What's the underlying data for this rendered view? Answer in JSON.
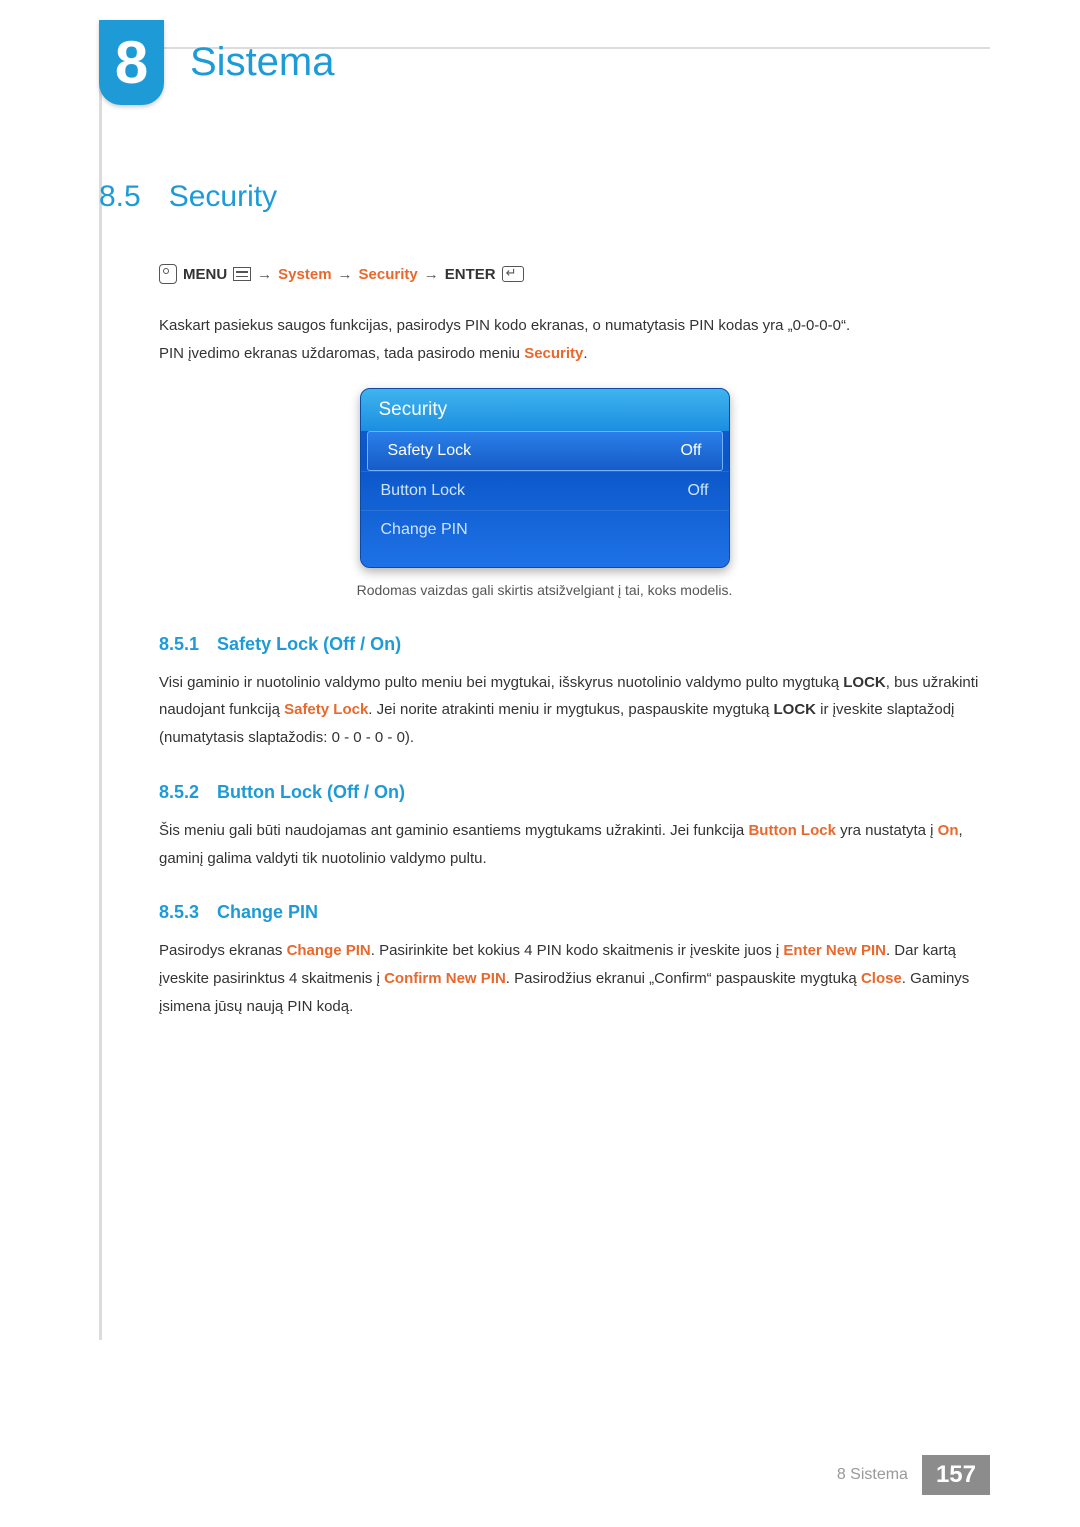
{
  "chapter": {
    "number": "8",
    "title": "Sistema"
  },
  "section": {
    "number": "8.5",
    "title": "Security"
  },
  "nav": {
    "menu": "MENU",
    "arrow": "→",
    "system": "System",
    "security": "Security",
    "enter": "ENTER"
  },
  "intro": {
    "line1": "Kaskart pasiekus saugos funkcijas, pasirodys PIN kodo ekranas, o numatytasis PIN kodas yra „0-0-0-0“.",
    "line2a": "PIN įvedimo ekranas uždaromas, tada pasirodo meniu ",
    "line2b": "Security",
    "line2c": "."
  },
  "osd": {
    "title": "Security",
    "rows": [
      {
        "label": "Safety Lock",
        "value": "Off",
        "selected": true
      },
      {
        "label": "Button Lock",
        "value": "Off",
        "selected": false
      },
      {
        "label": "Change PIN",
        "value": "",
        "selected": false
      }
    ]
  },
  "caption": "Rodomas vaizdas gali skirtis atsižvelgiant į tai, koks modelis.",
  "sub1": {
    "num": "8.5.1",
    "title": "Safety Lock (Off / On)",
    "p1": "Visi gaminio ir nuotolinio valdymo pulto meniu bei mygtukai, išskyrus nuotolinio valdymo pulto mygtuką ",
    "p2": "LOCK",
    "p3": ", bus užrakinti naudojant funkciją ",
    "p4": "Safety Lock",
    "p5": ". Jei norite atrakinti meniu ir mygtukus, paspauskite mygtuką ",
    "p6": "LOCK",
    "p7": " ir įveskite slaptažodį (numatytasis slaptažodis: 0 - 0 - 0 - 0)."
  },
  "sub2": {
    "num": "8.5.2",
    "title": "Button Lock (Off / On)",
    "p1": "Šis meniu gali būti naudojamas ant gaminio esantiems mygtukams užrakinti. Jei funkcija ",
    "p2": "Button Lock",
    "p3": " yra nustatyta į ",
    "p4": "On",
    "p5": ", gaminį galima valdyti tik nuotolinio valdymo pultu."
  },
  "sub3": {
    "num": "8.5.3",
    "title": "Change PIN",
    "p1": "Pasirodys ekranas ",
    "p2": "Change PIN",
    "p3": ". Pasirinkite bet kokius 4 PIN kodo skaitmenis ir įveskite juos į ",
    "p4": "Enter New PIN",
    "p5": ". Dar kartą įveskite pasirinktus 4 skaitmenis į ",
    "p6": "Confirm New PIN",
    "p7": ". Pasirodžius ekranui „Confirm“ paspauskite mygtuką ",
    "p8": "Close",
    "p9": ". Gaminys įsimena jūsų naują PIN kodą."
  },
  "footer": {
    "label": "8 Sistema",
    "page": "157"
  }
}
